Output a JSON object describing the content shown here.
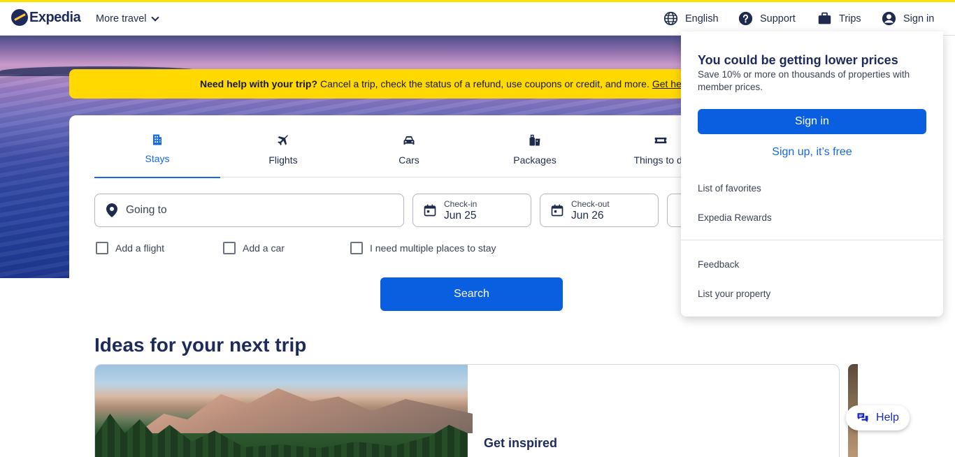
{
  "header": {
    "logo_text": "Expedia",
    "more_travel": "More travel",
    "nav": {
      "language": "English",
      "support": "Support",
      "trips": "Trips",
      "sign_in": "Sign in"
    }
  },
  "banner": {
    "bold": "Need help with your trip?",
    "text": "Cancel a trip, check the status of a refund, use coupons or credit, and more.",
    "link": "Get help"
  },
  "tabs": [
    {
      "label": "Stays",
      "icon": "building-icon",
      "active": true
    },
    {
      "label": "Flights",
      "icon": "plane-icon",
      "active": false
    },
    {
      "label": "Cars",
      "icon": "car-icon",
      "active": false
    },
    {
      "label": "Packages",
      "icon": "suitcase-icon",
      "active": false
    },
    {
      "label": "Things to do",
      "icon": "ticket-icon",
      "active": false
    }
  ],
  "search": {
    "going_to_placeholder": "Going to",
    "checkin_label": "Check-in",
    "checkin_value": "Jun 25",
    "checkout_label": "Check-out",
    "checkout_value": "Jun 26",
    "add_flight": "Add a flight",
    "add_car": "Add a car",
    "multiple_places": "I need multiple places to stay",
    "button": "Search"
  },
  "ideas": {
    "title": "Ideas for your next trip",
    "card_heading": "Get inspired"
  },
  "help_button": "Help",
  "account_menu": {
    "heading": "You could be getting lower prices",
    "subtext": "Save 10% or more on thousands of properties with member prices.",
    "sign_in_button": "Sign in",
    "sign_up_link": "Sign up, it’s free",
    "items_top": [
      "List of favorites",
      "Expedia Rewards"
    ],
    "items_bottom": [
      "Feedback",
      "List your property"
    ]
  },
  "colors": {
    "brand_yellow": "#ffd900",
    "primary_blue": "#0a5fe0",
    "link_blue": "#1668e3",
    "navy": "#1e2a5c"
  }
}
